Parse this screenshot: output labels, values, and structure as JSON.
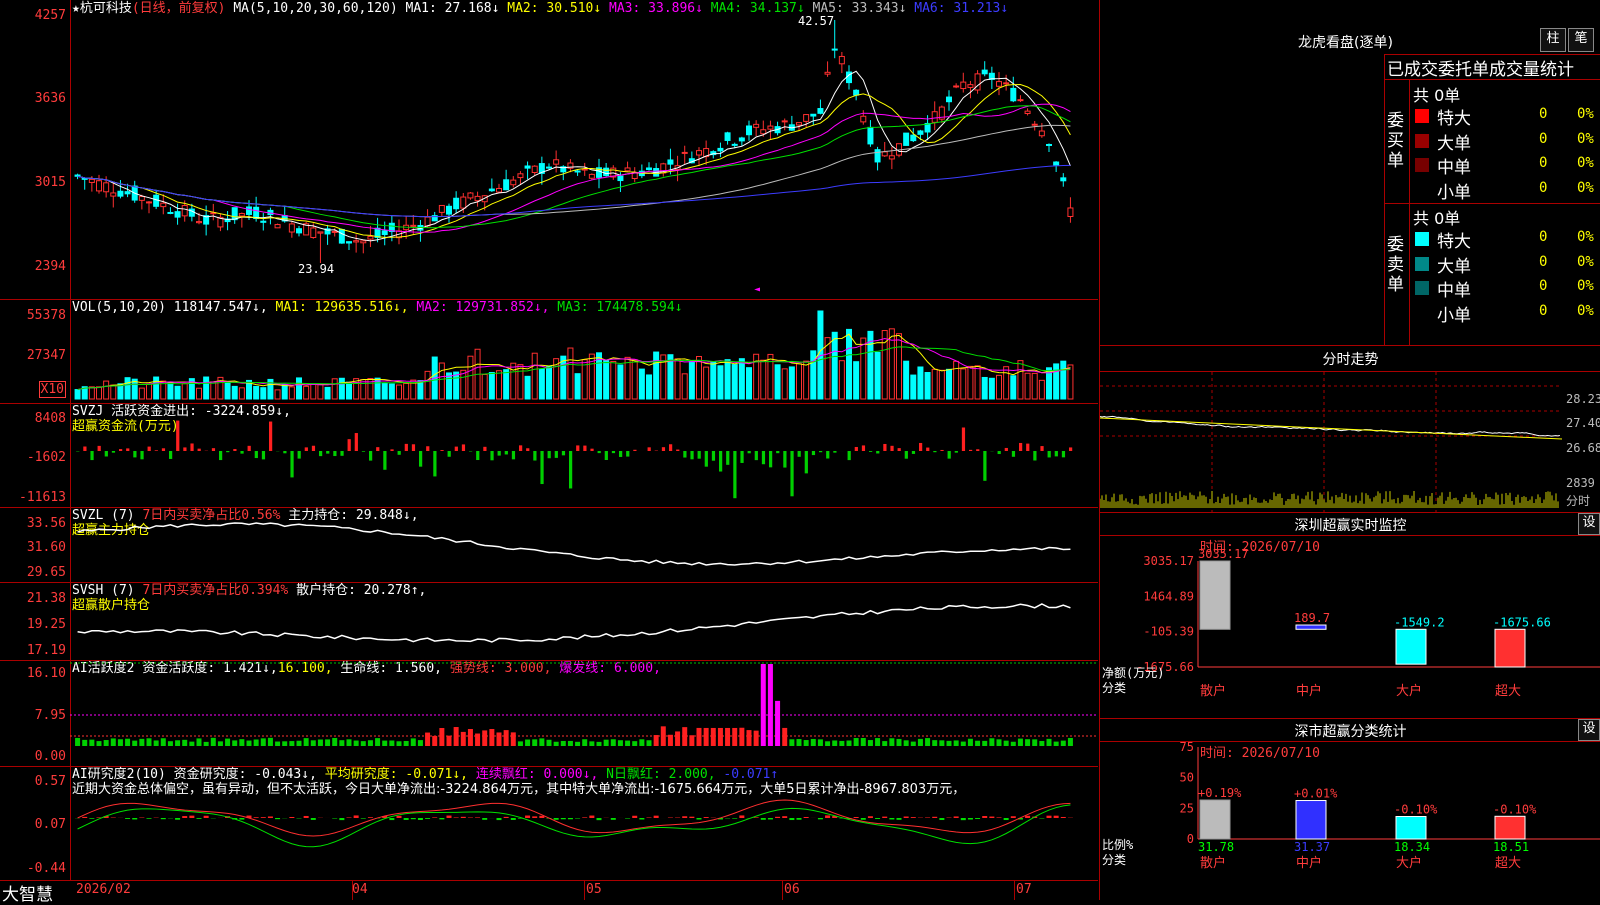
{
  "stock": {
    "name": "杭可科技",
    "mode": "(日线，前复权)",
    "star": "★"
  },
  "main": {
    "ma_title": "MA(5,10,20,30,60,120)",
    "ma": [
      {
        "label": "MA1:",
        "value": "27.168",
        "arrow": "↓",
        "color": "#ffffff"
      },
      {
        "label": "MA2:",
        "value": "30.510",
        "arrow": "↓",
        "color": "#ffff00"
      },
      {
        "label": "MA3:",
        "value": "33.896",
        "arrow": "↓",
        "color": "#ff00ff"
      },
      {
        "label": "MA4:",
        "value": "34.137",
        "arrow": "↓",
        "color": "#00e000"
      },
      {
        "label": "MA5:",
        "value": "33.343",
        "arrow": "↓",
        "color": "#bbbbbb"
      },
      {
        "label": "MA6:",
        "value": "31.213",
        "arrow": "↓",
        "color": "#3c3cff"
      }
    ],
    "yticks": [
      "4257",
      "3636",
      "3015",
      "2394"
    ],
    "high_label": "42.57",
    "low_label": "23.94"
  },
  "vol": {
    "title": "VOL(5,10,20)",
    "value": "118147.547↓,",
    "ma1": "MA1: 129635.516↓,",
    "ma2": "MA2: 129731.852↓,",
    "ma3": "MA3: 174478.594↓",
    "yticks": [
      "55378",
      "27347"
    ],
    "unit": "X10"
  },
  "svzj": {
    "title": "SVZJ",
    "label": "活跃资金进出:",
    "value": "-3224.859↓,",
    "sub": "超赢资金流(万元)",
    "yticks": [
      "8408",
      "-1602",
      "-11613"
    ]
  },
  "svzl": {
    "title": "SVZL (7)",
    "pct": "7日内买卖净占比0.56%",
    "label": "主力持仓:",
    "value": "29.848↓,",
    "sub": "超赢主力持仓",
    "yticks": [
      "33.56",
      "31.60",
      "29.65"
    ]
  },
  "svsh": {
    "title": "SVSH (7)",
    "pct": "7日内买卖净占比0.394%",
    "label": "散户持仓:",
    "value": "20.278↑,",
    "sub": "超赢散户持仓",
    "yticks": [
      "21.38",
      "19.25",
      "17.19"
    ]
  },
  "ai2": {
    "title": "AI活跃度2",
    "a": "资金活跃度: 1.421↓,",
    "b": "16.100,",
    "c": "生命线: 1.560,",
    "d": "强势线: 3.000,",
    "e": "爆发线: 6.000,",
    "yticks": [
      "16.10",
      "7.95",
      "0.00"
    ]
  },
  "ai_res": {
    "title": "AI研究度2(10)",
    "a": "资金研究度: -0.043↓,",
    "b": "平均研究度: -0.071↓,",
    "c": "连续飘红: 0.000↓,",
    "d": "N日飘红: 2.000,",
    "e": "-0.071↑",
    "text": "近期大资金总体偏空，虽有异动，但不太活跃，今日大单净流出:-3224.864万元，其中特大单净流出:-1675.664万元，大单5日累计净出-8967.803万元，",
    "yticks": [
      "0.57",
      "0.07",
      "-0.44"
    ]
  },
  "xaxis": {
    "logo": "大智慧",
    "labels": [
      "2026/02",
      "04",
      "05",
      "06",
      "07"
    ]
  },
  "dragon": {
    "title": "龙虎看盘(逐单)",
    "btn1": "柱",
    "btn2": "笔",
    "header": "已成交委托单成交量统计",
    "buy": {
      "side": "委买单",
      "total": "共 0单",
      "rows": [
        {
          "name": "特大",
          "v": "0",
          "p": "0%"
        },
        {
          "name": "大单",
          "v": "0",
          "p": "0%"
        },
        {
          "name": "中单",
          "v": "0",
          "p": "0%"
        },
        {
          "name": "小单",
          "v": "0",
          "p": "0%"
        }
      ]
    },
    "sell": {
      "side": "委卖单",
      "total": "共 0单",
      "rows": [
        {
          "name": "特大",
          "v": "0",
          "p": "0%"
        },
        {
          "name": "大单",
          "v": "0",
          "p": "0%"
        },
        {
          "name": "中单",
          "v": "0",
          "p": "0%"
        },
        {
          "name": "小单",
          "v": "0",
          "p": "0%"
        }
      ]
    }
  },
  "fenshi": {
    "title": "分时走势",
    "yticks": [
      "28.23",
      "27.40",
      "26.68"
    ],
    "vol": "2839",
    "unit": "分时"
  },
  "monitor": {
    "title": "深圳超赢实时监控",
    "btn": "设",
    "time": "时间: 2026/07/10",
    "yticks": [
      "3035.17",
      "1464.89",
      "-105.39",
      "-1675.66"
    ],
    "ylab": "净额(万元)",
    "xlab": "分类",
    "bars": [
      {
        "name": "散户",
        "v": 3035.17,
        "label": "3035.17"
      },
      {
        "name": "中户",
        "v": 189.7,
        "label": "189.7"
      },
      {
        "name": "大户",
        "v": -1549.2,
        "label": "-1549.2"
      },
      {
        "name": "超大",
        "v": -1675.66,
        "label": "-1675.66"
      }
    ]
  },
  "stats": {
    "title": "深市超赢分类统计",
    "btn": "设",
    "time": "时间: 2026/07/10",
    "yticks": [
      "75",
      "50",
      "25",
      "0"
    ],
    "ylab": "比例%",
    "xlab": "分类",
    "bars": [
      {
        "name": "散户",
        "v": 31.78,
        "chg": "+0.19%",
        "label": "31.78"
      },
      {
        "name": "中户",
        "v": 31.37,
        "chg": "+0.01%",
        "label": "31.37"
      },
      {
        "name": "大户",
        "v": 18.34,
        "chg": "-0.10%",
        "label": "18.34"
      },
      {
        "name": "超大",
        "v": 18.51,
        "chg": "-0.10%",
        "label": "18.51"
      }
    ]
  },
  "chart_data": {
    "type": "candlestick",
    "ylim": [
      23.94,
      42.57
    ],
    "high": 42.57,
    "low": 23.94
  }
}
